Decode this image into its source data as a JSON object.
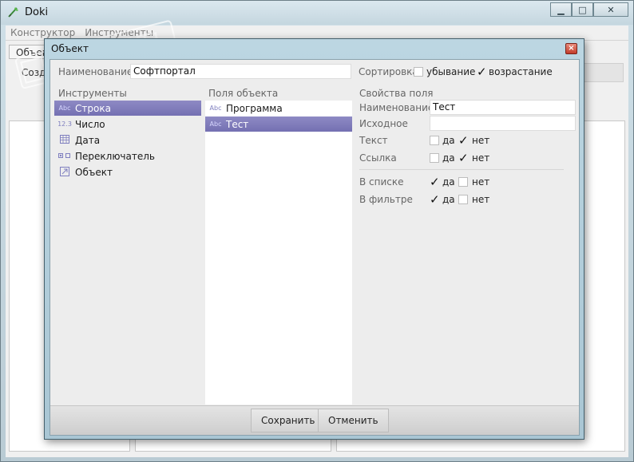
{
  "app": {
    "title": "Doki",
    "menu": [
      "Конструктор",
      "Инструменты"
    ],
    "bg_tab": "Объект",
    "bg_button": "Созд"
  },
  "dialog": {
    "title": "Объект",
    "close_symbol": "×",
    "name_label": "Наименование",
    "name_value": "Софтпортал",
    "sort_label": "Сортировка",
    "sort_desc_label": "убывание",
    "sort_desc_checked": false,
    "sort_asc_label": "возрастание",
    "sort_asc_checked": true,
    "tools": {
      "header": "Инструменты",
      "items": [
        {
          "label": "Строка",
          "icon": "Abc",
          "selected": true
        },
        {
          "label": "Число",
          "icon": "12.3",
          "selected": false
        },
        {
          "label": "Дата",
          "icon": "calendar-icon",
          "selected": false
        },
        {
          "label": "Переключатель",
          "icon": "switch-icon",
          "selected": false
        },
        {
          "label": "Объект",
          "icon": "object-link-icon",
          "selected": false
        }
      ]
    },
    "fields": {
      "header": "Поля объекта",
      "items": [
        {
          "label": "Программа",
          "icon": "Abc",
          "selected": false
        },
        {
          "label": "Тест",
          "icon": "Abc",
          "selected": true
        }
      ]
    },
    "props": {
      "header": "Свойства поля",
      "name_label": "Наименование",
      "name_value": "Тест",
      "source_label": "Исходное",
      "source_value": "",
      "text_label": "Текст",
      "link_label": "Ссылка",
      "in_list_label": "В списке",
      "in_filter_label": "В фильтре",
      "yes": "да",
      "no": "нет",
      "text_yes": false,
      "text_no": true,
      "link_yes": false,
      "link_no": true,
      "in_list_yes": true,
      "in_list_no": false,
      "in_filter_yes": true,
      "in_filter_no": false,
      "check_mark": "✓"
    },
    "save_label": "Сохранить",
    "cancel_label": "Отменить"
  }
}
